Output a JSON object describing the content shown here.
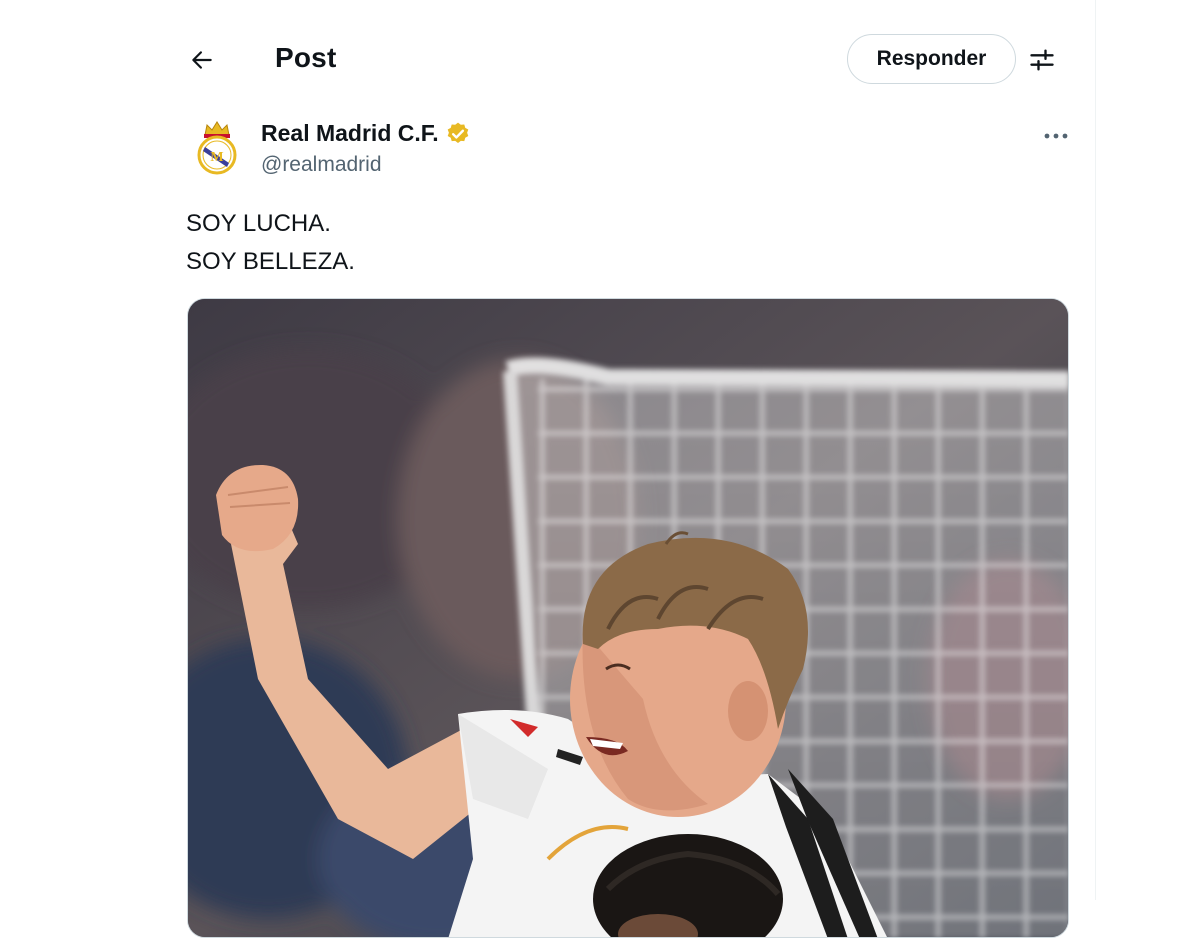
{
  "header": {
    "title": "Post",
    "reply_label": "Responder",
    "back_icon": "arrow-left-icon",
    "filter_icon": "sliders-icon"
  },
  "post": {
    "author_name": "Real Madrid C.F.",
    "author_handle": "@realmadrid",
    "verified_icon": "verified-badge-icon",
    "verified_color": "#e8b923",
    "more_icon": "more-horizontal-icon",
    "text_lines": [
      "SOY LUCHA.",
      "SOY BELLEZA."
    ],
    "media_alt": "Player celebrating with raised fist"
  },
  "colors": {
    "text_primary": "#0f1419",
    "text_secondary": "#536471",
    "border": "#cfd9de"
  }
}
